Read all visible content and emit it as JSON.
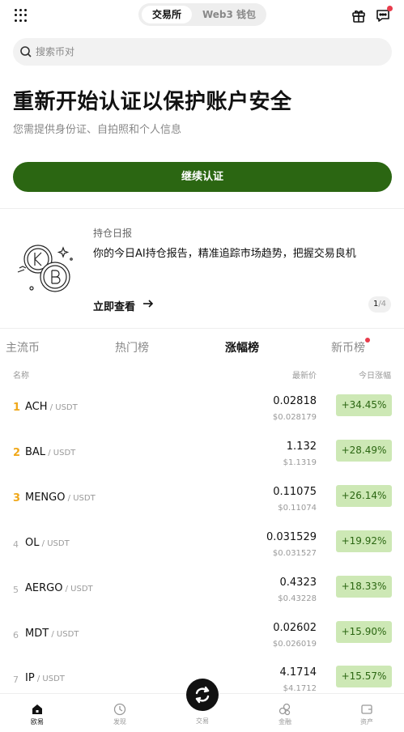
{
  "header": {
    "tabs": [
      "交易所",
      "Web3 钱包"
    ],
    "active_tab": "交易所"
  },
  "search": {
    "placeholder": "搜索币对"
  },
  "verify": {
    "title": "重新开始认证以保护账户安全",
    "subtitle": "您需提供身份证、自拍照和个人信息",
    "button": "继续认证"
  },
  "card": {
    "label": "持仓日报",
    "text": "你的今日AI持仓报告，精准追踪市场趋势，把握交易良机",
    "link": "立即查看",
    "page_current": "1",
    "page_total": "/4"
  },
  "market_tabs": [
    "主流币",
    "热门榜",
    "涨幅榜",
    "新币榜"
  ],
  "active_market_tab": "涨幅榜",
  "table_headers": {
    "name": "名称",
    "price": "最新价",
    "change": "今日涨幅"
  },
  "rows": [
    {
      "rank": "1",
      "symbol": "ACH",
      "pair": " / USDT",
      "price": "0.02818",
      "usd": "$0.028179",
      "change": "+34.45%"
    },
    {
      "rank": "2",
      "symbol": "BAL",
      "pair": " / USDT",
      "price": "1.132",
      "usd": "$1.1319",
      "change": "+28.49%"
    },
    {
      "rank": "3",
      "symbol": "MENGO",
      "pair": " / USDT",
      "price": "0.11075",
      "usd": "$0.11074",
      "change": "+26.14%"
    },
    {
      "rank": "4",
      "symbol": "OL",
      "pair": " / USDT",
      "price": "0.031529",
      "usd": "$0.031527",
      "change": "+19.92%"
    },
    {
      "rank": "5",
      "symbol": "AERGO",
      "pair": " / USDT",
      "price": "0.4323",
      "usd": "$0.43228",
      "change": "+18.33%"
    },
    {
      "rank": "6",
      "symbol": "MDT",
      "pair": " / USDT",
      "price": "0.02602",
      "usd": "$0.026019",
      "change": "+15.90%"
    },
    {
      "rank": "7",
      "symbol": "IP",
      "pair": " / USDT",
      "price": "4.1714",
      "usd": "$4.1712",
      "change": "+15.57%"
    }
  ],
  "bottom_nav": [
    "欧易",
    "发现",
    "交易",
    "金融",
    "资产"
  ],
  "colors": {
    "accent": "#2b6612",
    "gain_bg": "#cde8b5",
    "rank_top": "#f0a81a",
    "badge": "#e83c4c"
  },
  "icons": [
    "grid-icon",
    "gift-icon",
    "chat-icon",
    "search-icon",
    "arrow-right-icon",
    "home-icon",
    "discover-icon",
    "swap-icon",
    "finance-icon",
    "wallet-icon"
  ]
}
